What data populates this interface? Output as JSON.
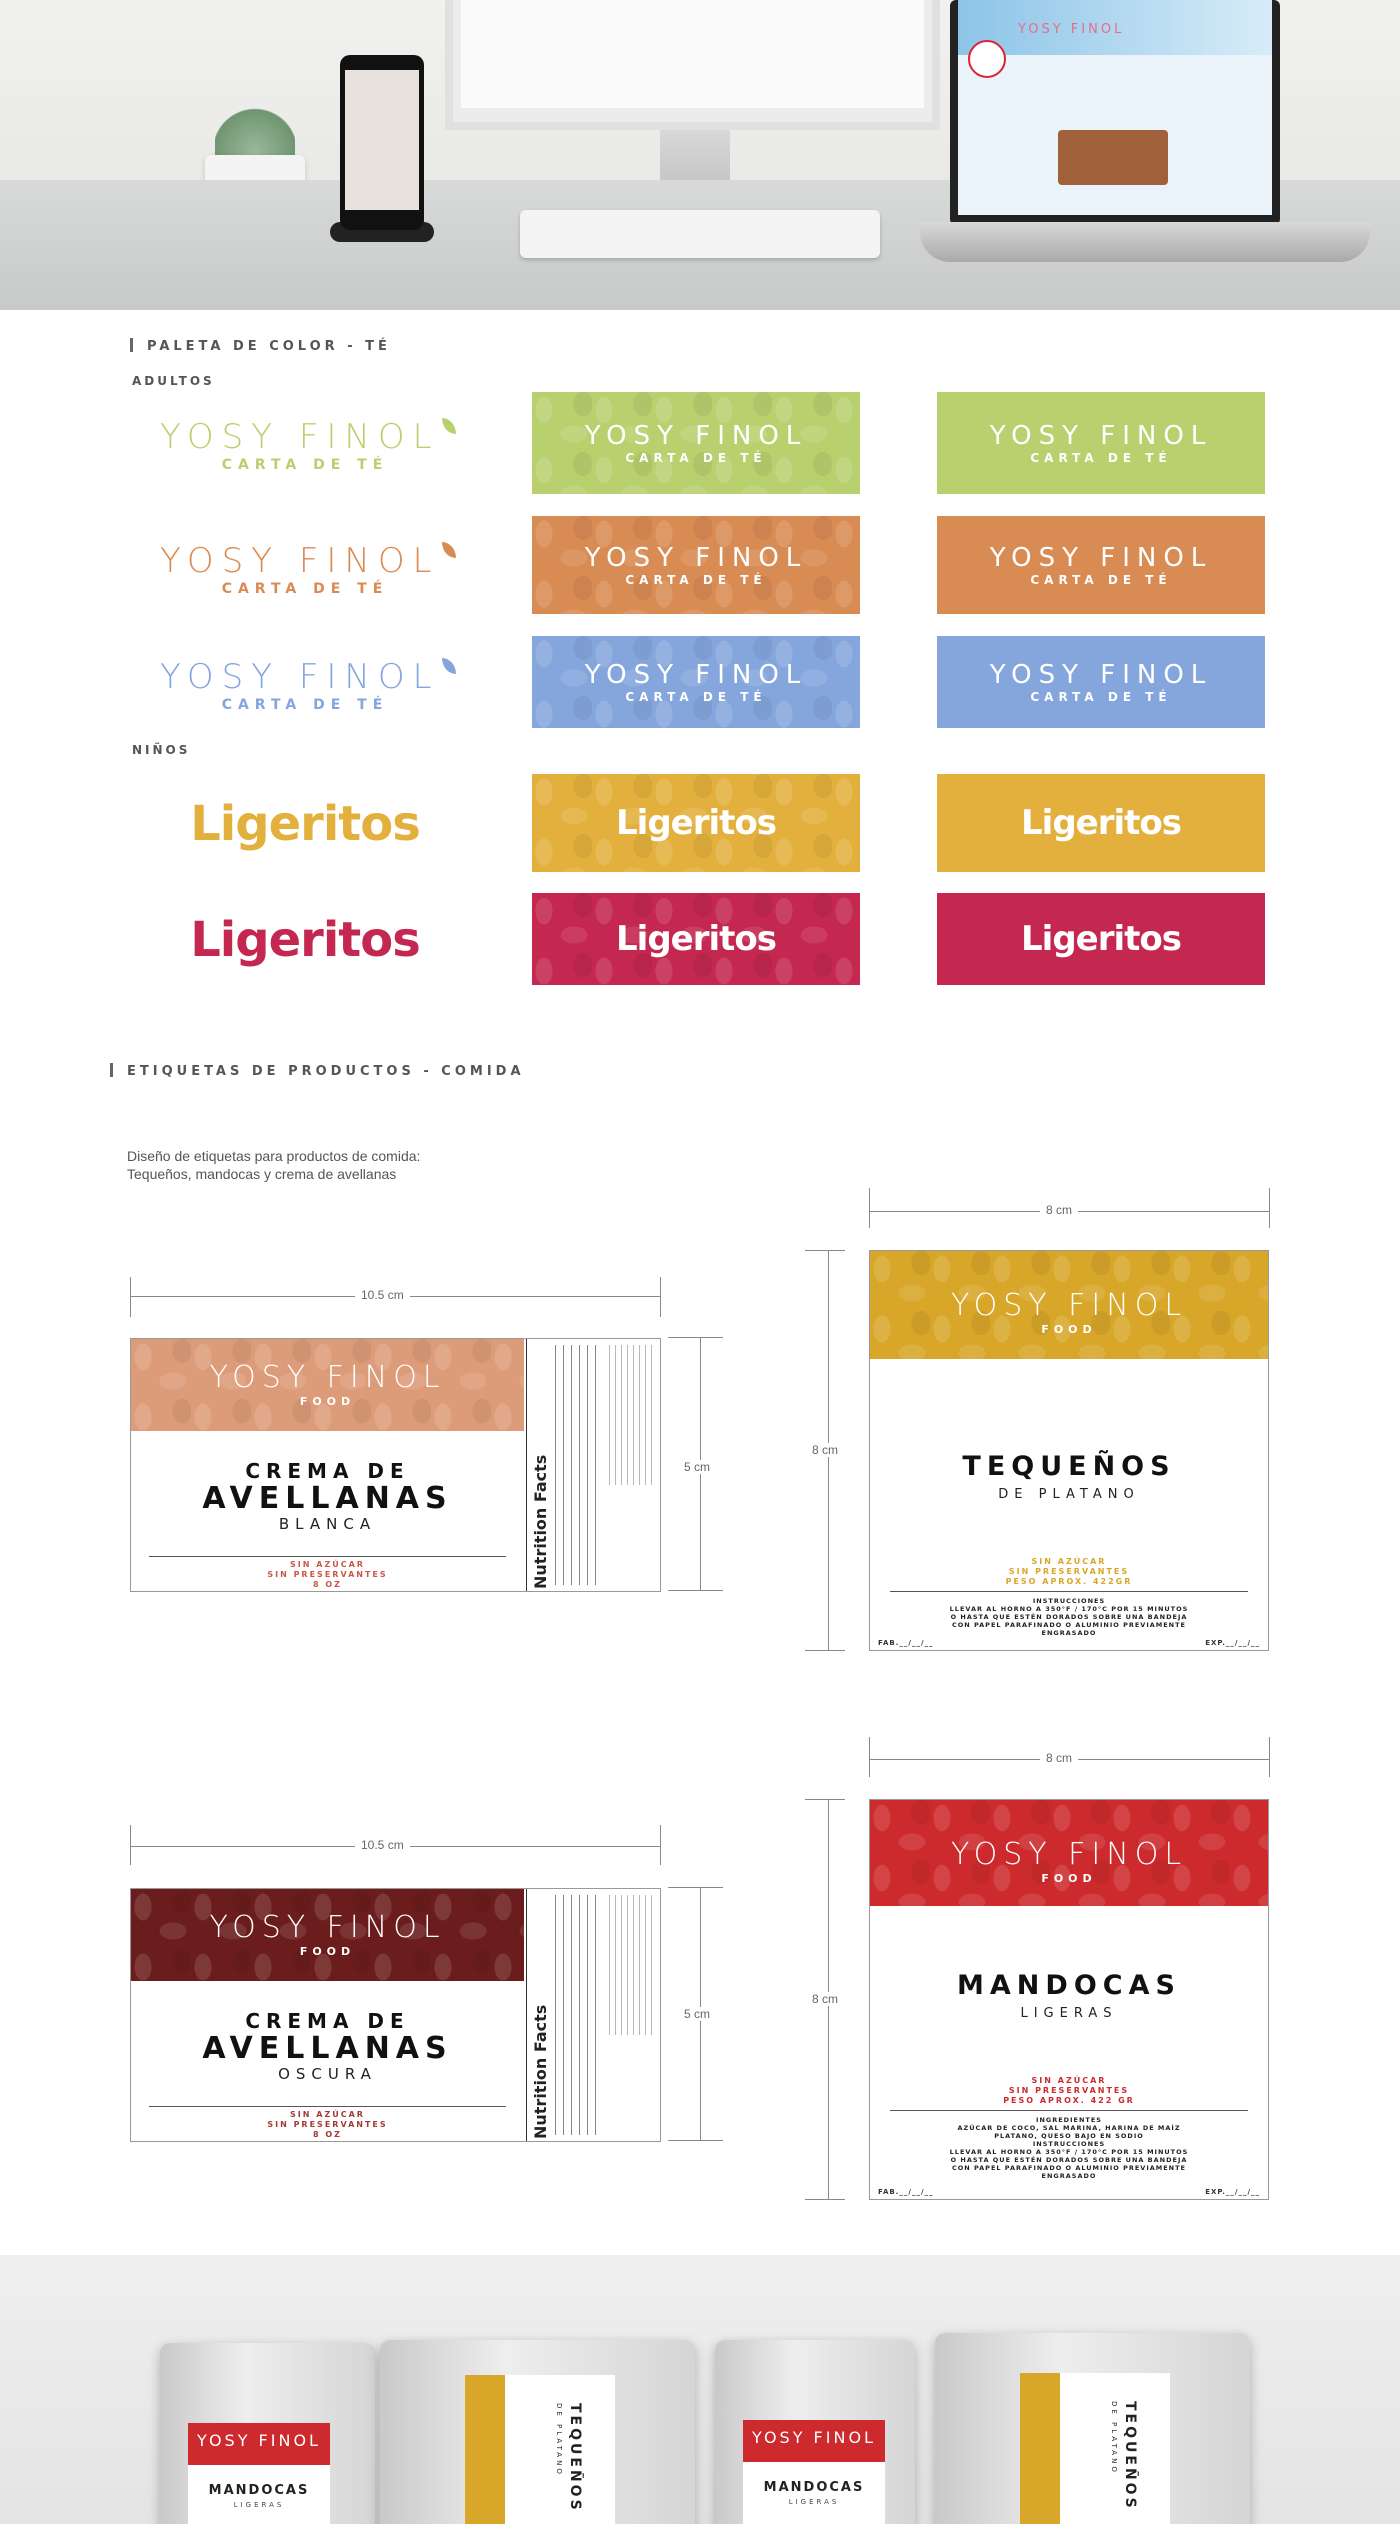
{
  "colors": {
    "green": "#b9d06f",
    "orange": "#d98b54",
    "blue": "#85a6dc",
    "yellow": "#e3b03d",
    "magenta": "#c4274f",
    "peach": "#dd9c79",
    "gold": "#d8a72a",
    "red": "#cc2a2c",
    "maroon": "#6b1d1d"
  },
  "hero": {
    "icons": [
      "monitor",
      "laptop",
      "phone",
      "plant"
    ]
  },
  "palette": {
    "section_title": "PALETA DE COLOR - TÉ",
    "adultos_label": "ADULTOS",
    "ninos_label": "NIÑOS",
    "brand": "YOSY FINOL",
    "sub": "CARTA DE TÉ",
    "kids_brand": "Ligeritos"
  },
  "labels_section": {
    "title": "ETIQUETAS DE PRODUCTOS - COMIDA",
    "desc_line1": "Diseño de etiquetas para productos de comida:",
    "desc_line2": "Tequeños, mandocas y crema de avellanas"
  },
  "dims": {
    "w_long": "10.5 cm",
    "h_short": "5 cm",
    "square": "8 cm"
  },
  "label_common": {
    "brand": "YOSY FINOL",
    "food": "FOOD",
    "sin_azucar": "SIN AZÚCAR",
    "sin_preservantes": "SIN PRESERVANTES",
    "fab": "FAB.__/__/__",
    "exp": "EXP.__/__/__",
    "nutrition": "Nutrition Facts"
  },
  "crema_blanca": {
    "line1": "CREMA DE",
    "line2": "AVELLANAS",
    "line3": "BLANCA",
    "weight": "8 OZ"
  },
  "crema_oscura": {
    "line1": "CREMA DE",
    "line2": "AVELLANAS",
    "line3": "OSCURA",
    "weight": "8 OZ"
  },
  "tequenos": {
    "name": "TEQUEÑOS",
    "sub": "DE PLATANO",
    "peso": "PESO APROX. 422GR",
    "instr_title": "INSTRUCCIONES",
    "instr1": "LLEVAR AL HORNO A 350°F / 170°C POR 15 MINUTOS",
    "instr2": "O HASTA QUE ESTÉN DORADOS SOBRE UNA BANDEJA",
    "instr3": "CON PAPEL PARAFINADO O ALUMINIO PREVIAMENTE",
    "instr4": "ENGRASADO"
  },
  "mandocas": {
    "name": "MANDOCAS",
    "sub": "LIGERAS",
    "peso": "PESO APROX. 422 GR",
    "ingr_title": "INGREDIENTES",
    "ingr1": "AZÚCAR DE COCO, SAL MARINA, HARINA DE MAÍZ",
    "ingr2": "PLATANO, QUESO BAJO EN SODIO",
    "instr_title": "INSTRUCCIONES",
    "instr1": "LLEVAR AL HORNO A 350°F / 170°C POR 15 MINUTOS",
    "instr2": "O HASTA QUE ESTÉN DORADOS SOBRE UNA BANDEJA",
    "instr3": "CON PAPEL PARAFINADO O ALUMINIO PREVIAMENTE",
    "instr4": "ENGRASADO"
  },
  "mockup": {
    "p1_name": "MANDOCAS",
    "p1_sub": "LIGERAS",
    "p2_name": "TEQUEÑOS",
    "p2_sub": "DE PLATANO",
    "p3_name": "MANDOCAS",
    "p3_sub": "LIGERAS",
    "p4_name": "TEQUEÑOS",
    "p4_sub": "DE PLATANO"
  }
}
